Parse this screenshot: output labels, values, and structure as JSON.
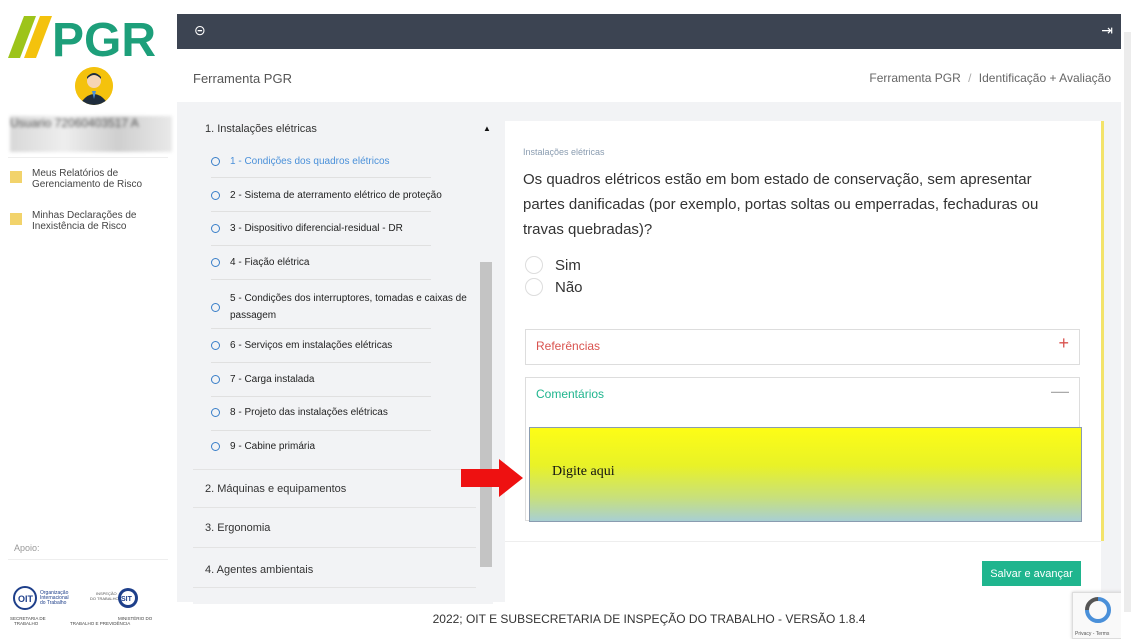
{
  "logo": {
    "text": "PGR"
  },
  "sidebar": {
    "username": "Usuario 72060403517 A",
    "items": [
      {
        "label": "Meus Relatórios de Gerenciamento de Risco",
        "icon": "folder-icon"
      },
      {
        "label": "Minhas Declarações de Inexistência de Risco",
        "icon": "folder-icon"
      }
    ],
    "apoio_label": "Apoio:",
    "logos": {
      "oit_line1": "Organização",
      "oit_line2": "Internacional",
      "oit_line3": "do Trabalho",
      "insp_line1": "INSPEÇÃO",
      "insp_line2": "DO TRABALHO",
      "sit": "SIT",
      "sec_line1": "SECRETARIA DE",
      "sec_line2": "TRABALHO",
      "min_line1": "MINISTÉRIO DO",
      "min_line2": "TRABALHO E PREVIDÊNCIA"
    }
  },
  "topbar": {
    "left_icon": "collapse-icon",
    "right_icon": "exit-icon"
  },
  "header": {
    "title": "Ferramenta PGR",
    "breadcrumb_root": "Ferramenta PGR",
    "breadcrumb_sep": "/",
    "breadcrumb_current": "Identificação + Avaliação"
  },
  "questions": {
    "section1": "1. Instalações elétricas",
    "items": [
      "1 - Condições dos quadros elétricos",
      "2 - Sistema de aterramento elétrico de proteção",
      "3 - Dispositivo diferencial-residual - DR",
      "4 - Fiação elétrica",
      "5 - Condições dos interruptores, tomadas e caixas de passagem",
      "6 - Serviços em instalações elétricas",
      "7 - Carga instalada",
      "8 - Projeto das instalações elétricas",
      "9 - Cabine primária"
    ],
    "section2": "2. Máquinas e equipamentos",
    "section3": "3. Ergonomia",
    "section4": "4. Agentes ambientais"
  },
  "card": {
    "category": "Instalações elétricas",
    "question": "Os quadros elétricos estão em bom estado de conservação, sem apresentar partes danificadas (por exemplo, portas soltas ou emperradas, fechaduras ou travas quebradas)?",
    "option_yes": "Sim",
    "option_no": "Não",
    "references_label": "Referências",
    "comments_label": "Comentários",
    "comment_value": "Digite aqui",
    "save_label": "Salvar e avançar"
  },
  "footer": {
    "text": "2022; OIT E SUBSECRETARIA DE INSPEÇÃO DO TRABALHO - VERSÃO 1.8.4"
  },
  "recaptcha": {
    "text": "Privacy - Terms"
  },
  "colors": {
    "accent": "#1fb58e",
    "topbar": "#3c4452",
    "link": "#4a90d9",
    "references": "#d9534f",
    "comments": "#1fb58e"
  }
}
